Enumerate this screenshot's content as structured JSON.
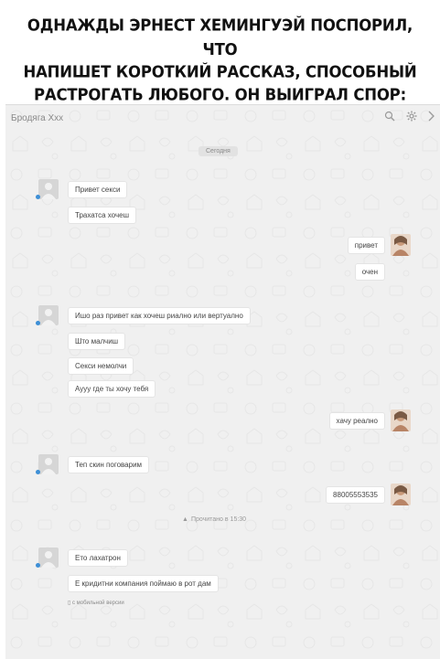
{
  "caption": {
    "line1": "Однажды Эрнест Хемингуэй поспорил, что",
    "line2": "напишет короткий рассказ, способный",
    "line3": "растрогать любого. Он выиграл спор:"
  },
  "chat": {
    "title": "Бродяга Xxx",
    "header_icons": [
      "search-icon",
      "gear-icon",
      "close-icon"
    ],
    "date_label": "Сегодня",
    "groups": [
      {
        "side": "left",
        "messages": [
          "Привет секси",
          "Трахатса хочеш"
        ]
      },
      {
        "side": "right",
        "messages": [
          "привет",
          "очен"
        ]
      },
      {
        "side": "left",
        "messages": [
          "Ишо раз привет как хочеш риално или вертуално",
          "Што малчиш",
          "Секси немолчи",
          "Аууу где ты хочу тебя"
        ]
      },
      {
        "side": "right",
        "messages": [
          "хачу реално"
        ]
      },
      {
        "side": "left",
        "messages": [
          "Теп скин поговарим"
        ]
      },
      {
        "side": "right",
        "messages": [
          "88005553535"
        ]
      },
      {
        "side": "left",
        "messages": [
          "Ето лахатрон",
          "Е кридитни компания поймаю в рот дам"
        ]
      }
    ],
    "read_status": "Прочитано в 15:30",
    "mobile_note": "с мобильной версии"
  }
}
